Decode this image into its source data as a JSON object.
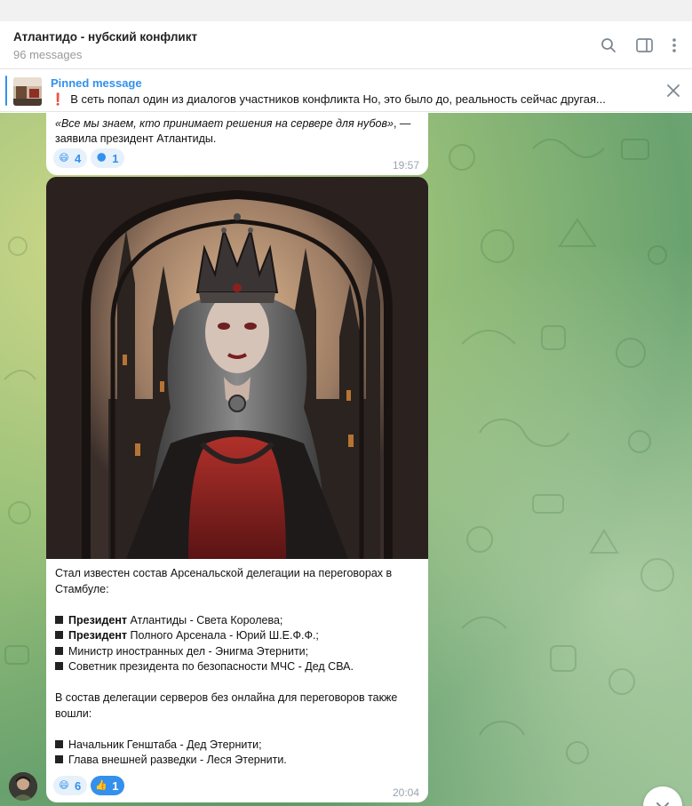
{
  "chat": {
    "title": "Атлантидо - нубский конфликт",
    "subtitle": "96 messages"
  },
  "header_icons": [
    "search-icon",
    "sidebar-toggle-icon",
    "more-vertical-icon"
  ],
  "pinned": {
    "label": "Pinned message",
    "exclamation": "❗",
    "text": "В сеть попал один из диалогов участников конфликта   Но, это было до, реальность сейчас другая..."
  },
  "messages": [
    {
      "quote_italic": "«Все мы знаем, кто принимает решения на сервере для нубов»",
      "quote_rest": ", — заявила президент Атлантиды.",
      "reactions": [
        {
          "emoji": "😄",
          "count": "4"
        },
        {
          "emoji": "🌑",
          "count": "1"
        }
      ],
      "time": "19:57"
    },
    {
      "paragraphs": {
        "intro": "Стал известен состав Арсенальской делегации на переговорах в Стамбуле:",
        "l1_bold": "Президент",
        "l1_rest": " Атлантиды - Света Королева;",
        "l2_bold": "Президент",
        "l2_rest": " Полного Арсенала - Юрий Ш.Е.Ф.Ф.;",
        "l3": "Министр иностранных дел - Энигма Этернити;",
        "l4": "Советник президента по безопасности МЧС - Дед СВА.",
        "intro2": "В состав делегации серверов без онлайна для переговоров также вошли:",
        "l5": "Начальник Генштаба - Дед Этернити;",
        "l6": "Глава внешней разведки - Леся Этернити."
      },
      "reactions": [
        {
          "emoji": "😄",
          "count": "6"
        },
        {
          "emoji": "👍",
          "count": "1"
        }
      ],
      "time": "20:04"
    }
  ]
}
